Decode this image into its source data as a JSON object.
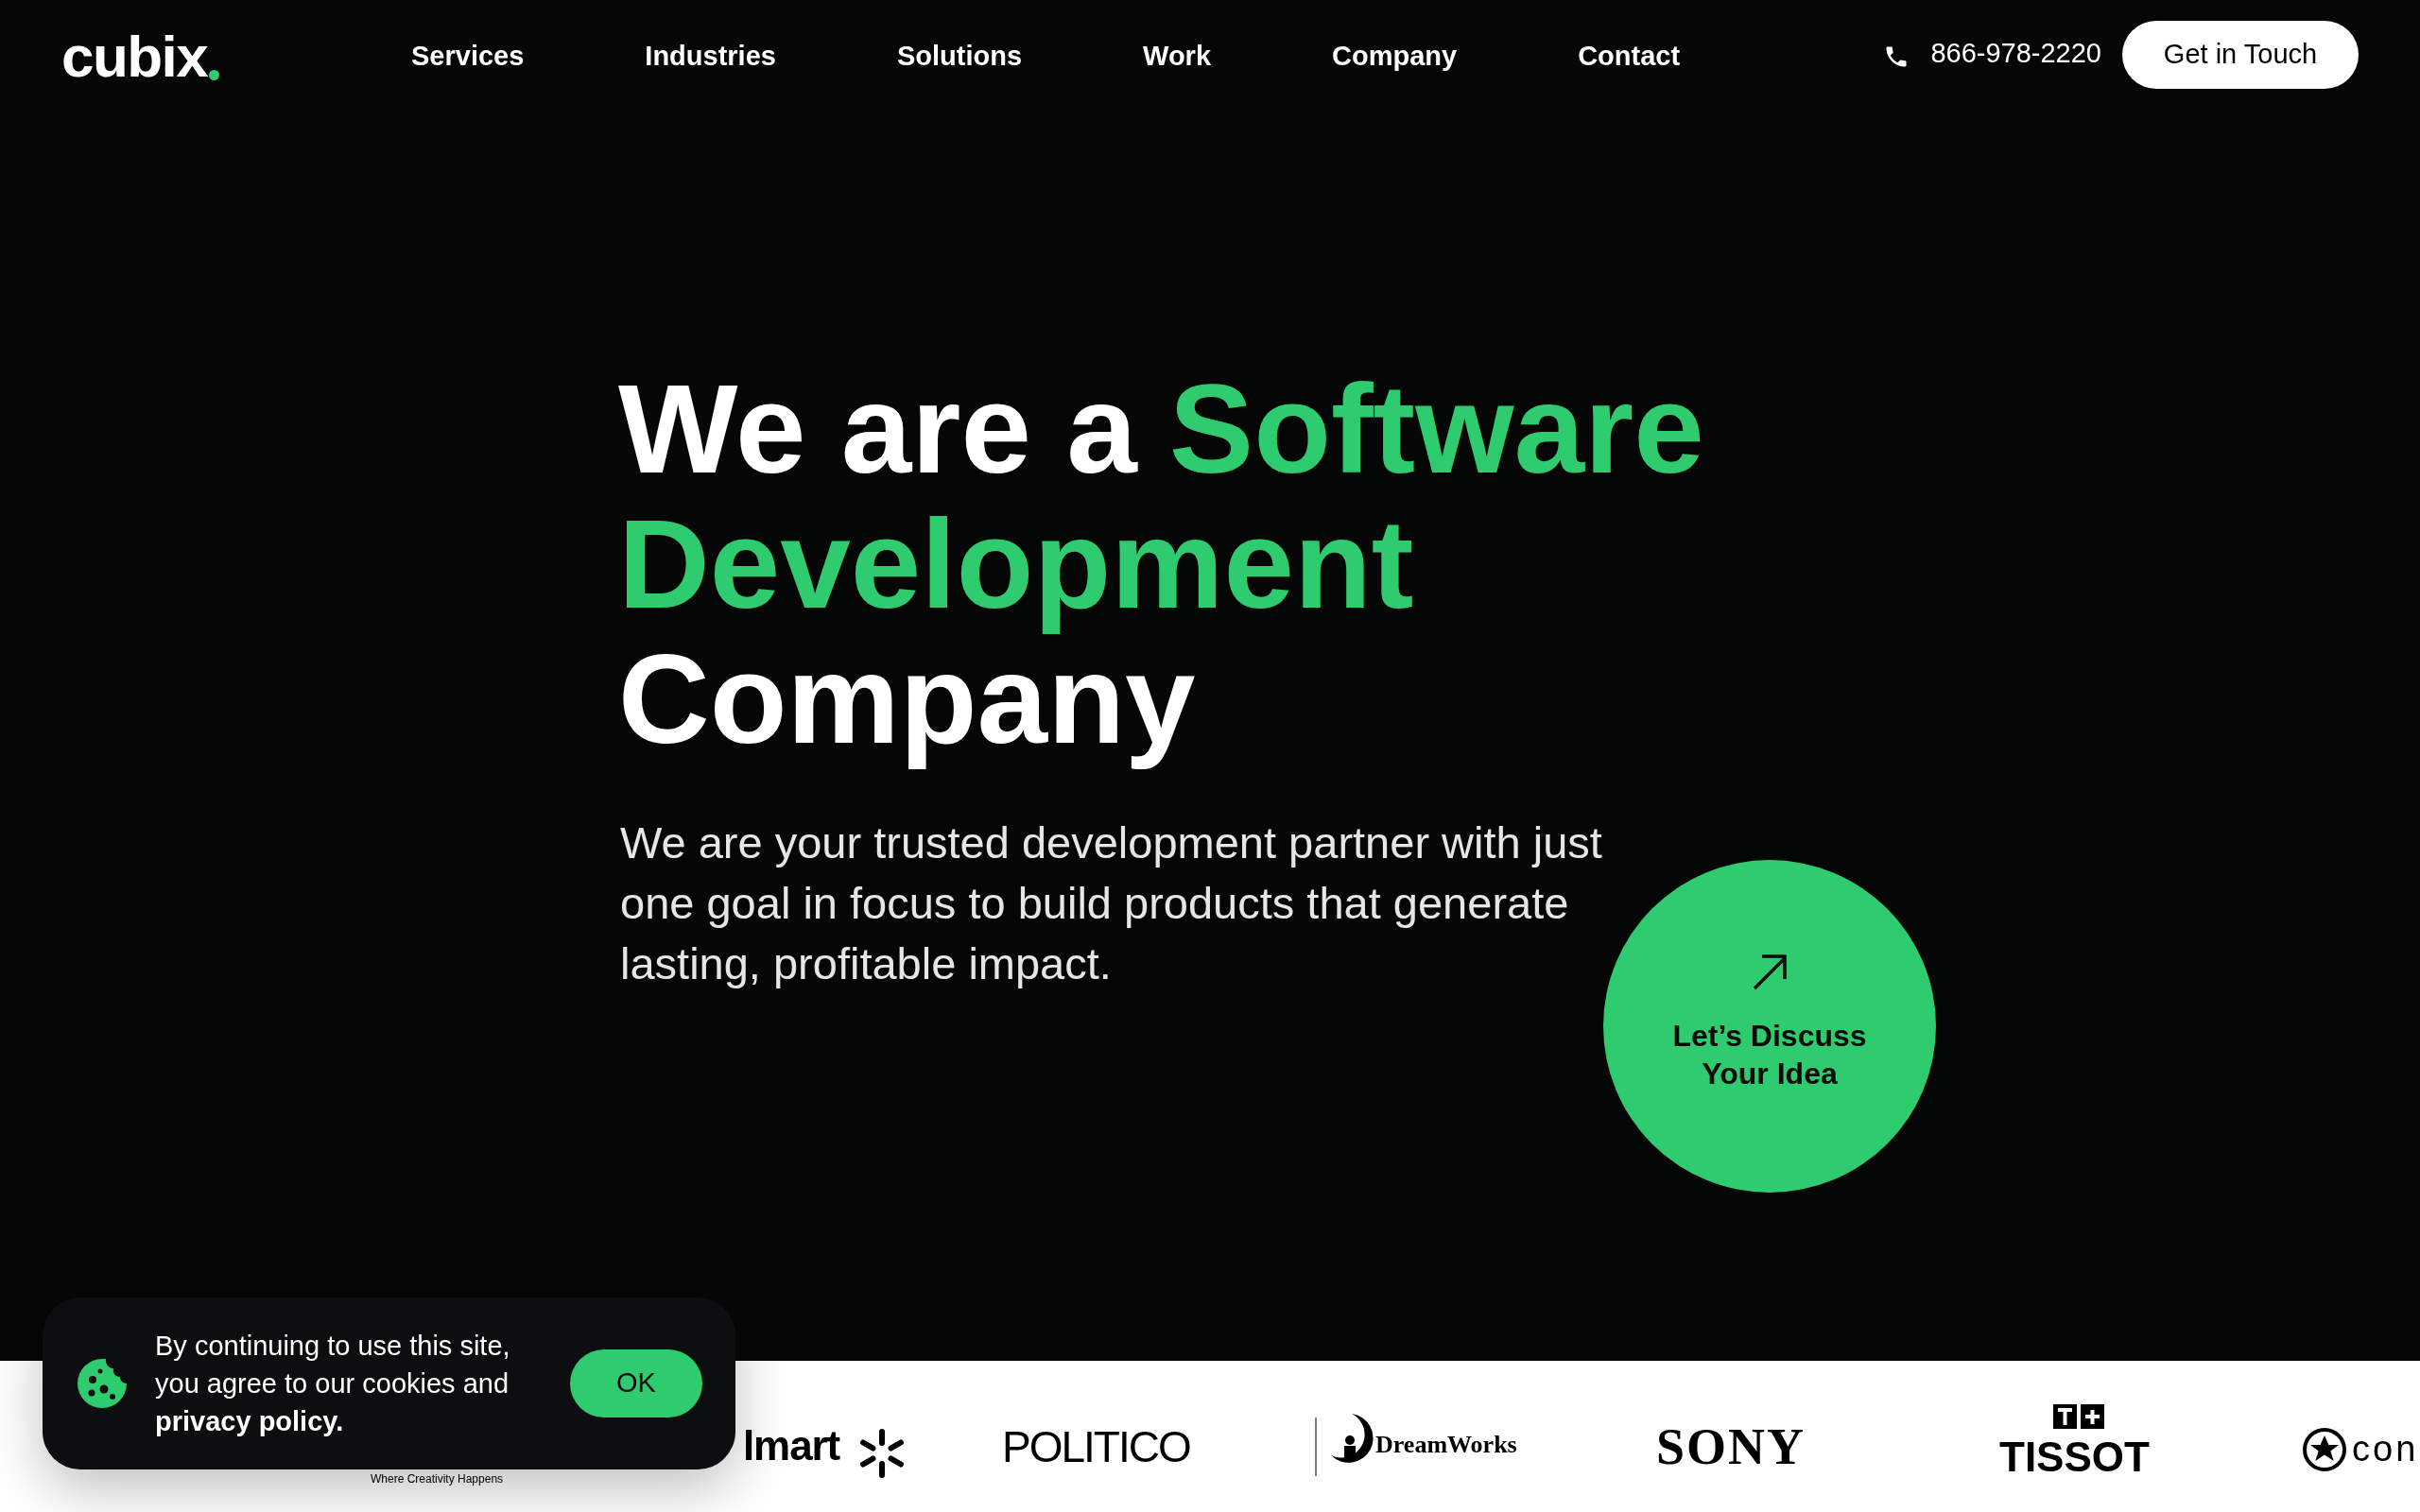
{
  "header": {
    "logo": "cubix",
    "nav": [
      {
        "label": "Services"
      },
      {
        "label": "Industries"
      },
      {
        "label": "Solutions"
      },
      {
        "label": "Work"
      },
      {
        "label": "Company"
      },
      {
        "label": "Contact"
      }
    ],
    "phone": "866-978-2220",
    "cta": "Get in Touch"
  },
  "hero": {
    "heading": [
      {
        "text": "We are a",
        "accent": false
      },
      {
        "text": "Software",
        "accent": true
      },
      {
        "text": "Development",
        "accent": true
      },
      {
        "text": "Company",
        "accent": false
      }
    ],
    "subtitle": "We are your trusted development partner with just one goal in focus to build products that generate lasting, profitable impact.",
    "discuss": "Let’s Discuss Your Idea"
  },
  "logos": [
    {
      "kind": "tagline",
      "text": "Where Creativity Happens"
    },
    {
      "kind": "walmart",
      "text": "lmart"
    },
    {
      "kind": "sans",
      "text": "POLITICO"
    },
    {
      "kind": "dreamworks",
      "text": "DreamWorks"
    },
    {
      "kind": "serif",
      "text": "SONY"
    },
    {
      "kind": "tissot",
      "text": "TISSOT"
    },
    {
      "kind": "converse",
      "text": "con"
    }
  ],
  "cookie": {
    "text": "By continuing to use this site, you agree to our cookies and **privacy policy.**",
    "button": "OK"
  }
}
